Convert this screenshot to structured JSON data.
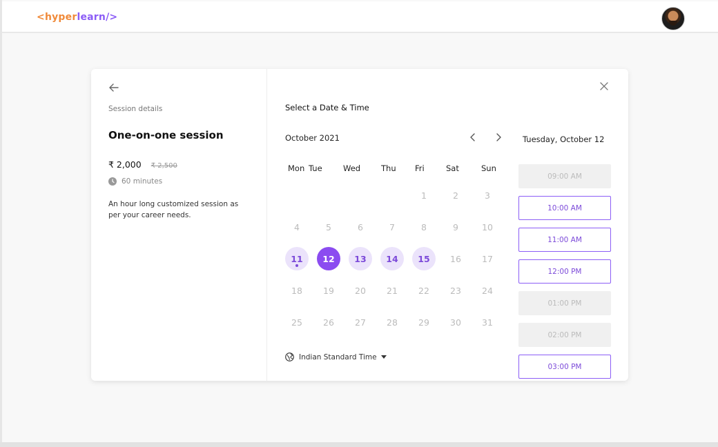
{
  "header": {
    "logo": {
      "open": "<",
      "hyper": "hyper",
      "learn": "learn",
      "close": "/>"
    },
    "accent_orange": "#f08a3a",
    "accent_purple": "#8b5cf6"
  },
  "session": {
    "back_icon": "arrow-left-icon",
    "label": "Session details",
    "title": "One-on-one session",
    "price": "₹ 2,000",
    "price_original": "₹ 2,500",
    "duration_icon": "clock-icon",
    "duration": "60 minutes",
    "description": "An hour long customized session as per your career needs."
  },
  "picker": {
    "close_icon": "close-icon",
    "title": "Select a Date & Time",
    "month": "October 2021",
    "prev_icon": "chevron-left-icon",
    "next_icon": "chevron-right-icon",
    "selected_date_label": "Tuesday, October 12",
    "weekdays": [
      "Mon",
      "Tue",
      "Wed",
      "Thu",
      "Fri",
      "Sat",
      "Sun"
    ],
    "days": [
      {
        "n": "1",
        "state": "disabled"
      },
      {
        "n": "2",
        "state": "disabled"
      },
      {
        "n": "3",
        "state": "disabled"
      },
      {
        "n": "4",
        "state": "disabled"
      },
      {
        "n": "5",
        "state": "disabled"
      },
      {
        "n": "6",
        "state": "disabled"
      },
      {
        "n": "7",
        "state": "disabled"
      },
      {
        "n": "8",
        "state": "disabled"
      },
      {
        "n": "9",
        "state": "disabled"
      },
      {
        "n": "10",
        "state": "disabled"
      },
      {
        "n": "11",
        "state": "available",
        "today": true
      },
      {
        "n": "12",
        "state": "selected"
      },
      {
        "n": "13",
        "state": "available"
      },
      {
        "n": "14",
        "state": "available"
      },
      {
        "n": "15",
        "state": "available"
      },
      {
        "n": "16",
        "state": "disabled"
      },
      {
        "n": "17",
        "state": "disabled"
      },
      {
        "n": "18",
        "state": "disabled"
      },
      {
        "n": "19",
        "state": "disabled"
      },
      {
        "n": "20",
        "state": "disabled"
      },
      {
        "n": "21",
        "state": "disabled"
      },
      {
        "n": "22",
        "state": "disabled"
      },
      {
        "n": "23",
        "state": "disabled"
      },
      {
        "n": "24",
        "state": "disabled"
      },
      {
        "n": "25",
        "state": "disabled"
      },
      {
        "n": "26",
        "state": "disabled"
      },
      {
        "n": "27",
        "state": "disabled"
      },
      {
        "n": "28",
        "state": "disabled"
      },
      {
        "n": "29",
        "state": "disabled"
      },
      {
        "n": "30",
        "state": "disabled"
      },
      {
        "n": "31",
        "state": "disabled"
      }
    ],
    "timezone_icon": "globe-icon",
    "timezone": "Indian Standard Time",
    "time_slots": [
      {
        "label": "09:00 AM",
        "available": false
      },
      {
        "label": "10:00 AM",
        "available": true
      },
      {
        "label": "11:00 AM",
        "available": true
      },
      {
        "label": "12:00 PM",
        "available": true
      },
      {
        "label": "01:00 PM",
        "available": false
      },
      {
        "label": "02:00 PM",
        "available": false
      },
      {
        "label": "03:00 PM",
        "available": true
      }
    ]
  }
}
